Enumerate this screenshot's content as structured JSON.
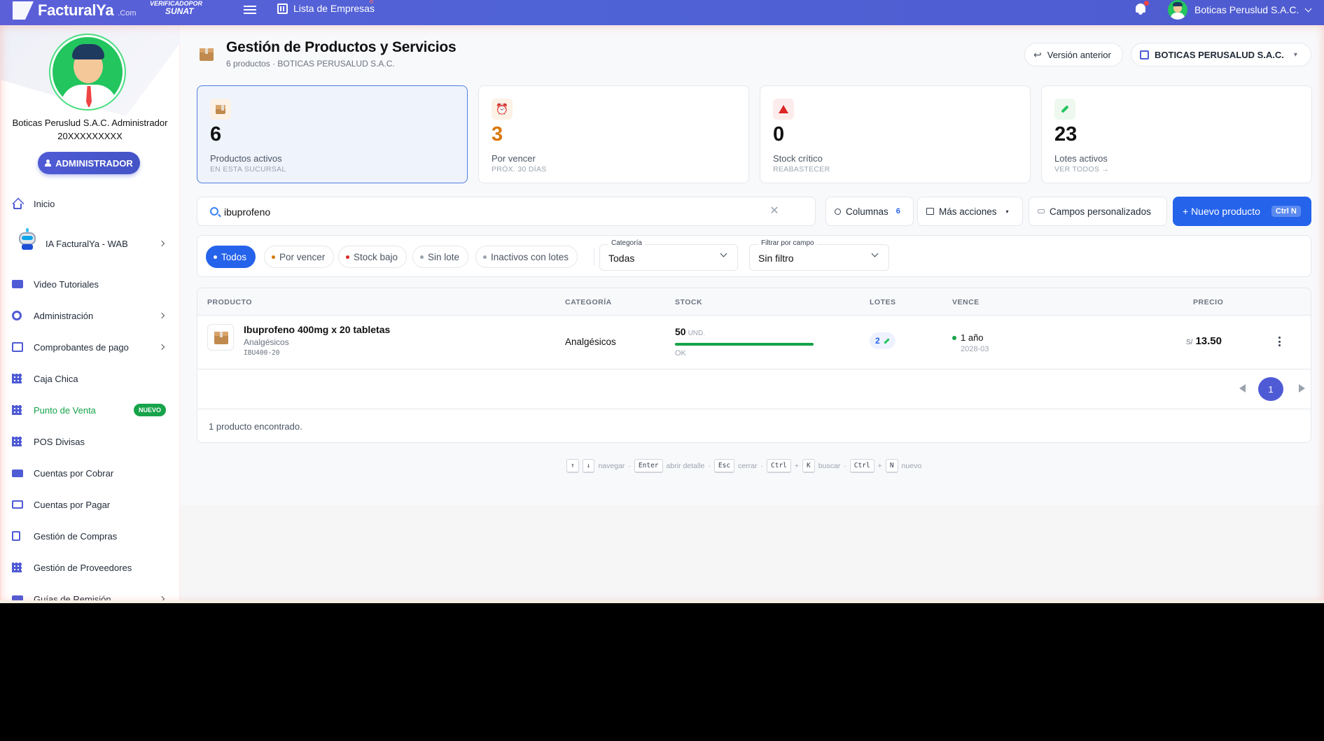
{
  "topbar": {
    "logo_text": "FacturalYa",
    "logo_suffix": ".Com",
    "verify_line1": "VERIFICADOPOR",
    "verify_line2": "SUNAT",
    "company_list_label": "Lista de Empresas",
    "user_name": "Boticas Peruslud S.A.C."
  },
  "sidebar": {
    "user_name": "Boticas Peruslud S.A.C. Administrador",
    "user_ruc": "20XXXXXXXXX",
    "role_label": "ADMINISTRADOR",
    "items": [
      {
        "label": "Inicio",
        "icon": "home-icon"
      },
      {
        "label": "IA FacturalYa - WAB",
        "icon": "robot-icon",
        "has_submenu": true
      },
      {
        "label": "Video Tutoriales",
        "icon": "video-icon"
      },
      {
        "label": "Administración",
        "icon": "gear-icon",
        "has_submenu": true
      },
      {
        "label": "Comprobantes de pago",
        "icon": "receipt-icon",
        "has_submenu": true
      },
      {
        "label": "Caja Chica",
        "icon": "calculator-icon"
      },
      {
        "label": "Punto de Venta",
        "icon": "store-icon",
        "badge": "NUEVO",
        "active": true
      },
      {
        "label": "POS Divisas",
        "icon": "store-icon"
      },
      {
        "label": "Cuentas por Cobrar",
        "icon": "money-icon"
      },
      {
        "label": "Cuentas por Pagar",
        "icon": "card-icon"
      },
      {
        "label": "Gestión de Compras",
        "icon": "bag-icon"
      },
      {
        "label": "Gestión de Proveedores",
        "icon": "store-icon"
      },
      {
        "label": "Guías de Remisión",
        "icon": "truck-icon",
        "has_submenu": true
      }
    ]
  },
  "header": {
    "title": "Gestión de Productos y Servicios",
    "subtitle": "6 productos · BOTICAS PERUSALUD S.A.C.",
    "prev_version_label": "Versión anterior",
    "company_selector": "BOTICAS PERUSALUD S.A.C."
  },
  "stats": [
    {
      "value": "6",
      "label": "Productos activos",
      "sub": "EN ESTA SUCURSAL",
      "icon": "box-icon",
      "value_color": "#111111"
    },
    {
      "value": "3",
      "label": "Por vencer",
      "sub": "PRÓX. 30 DÍAS",
      "icon": "alarm-clock-icon",
      "value_color": "#d97706"
    },
    {
      "value": "0",
      "label": "Stock crítico",
      "sub": "REABASTECER",
      "icon": "warning-icon",
      "value_color": "#111111"
    },
    {
      "value": "23",
      "label": "Lotes activos",
      "sub": "VER TODOS →",
      "icon": "syringe-icon",
      "value_color": "#111111"
    }
  ],
  "search": {
    "value": "ibuprofeno",
    "clear_glyph": "✕"
  },
  "actions": {
    "columns_label": "Columnas",
    "columns_count": "6",
    "more_label": "Más acciones",
    "custom_fields_label": "Campos personalizados",
    "new_product_label": "+ Nuevo producto",
    "new_product_shortcut": "Ctrl N"
  },
  "filters": {
    "chips": [
      {
        "label": "Todos",
        "active": true,
        "dot_color": "#ffffff"
      },
      {
        "label": "Por vencer",
        "dot_color": "#d97706"
      },
      {
        "label": "Stock bajo",
        "dot_color": "#dc2626"
      },
      {
        "label": "Sin lote",
        "dot_color": "#9ca3af"
      },
      {
        "label": "Inactivos con lotes",
        "dot_color": "#9ca3af"
      }
    ],
    "category_caption": "Categoría",
    "category_value": "Todas",
    "field_caption": "Filtrar por campo",
    "field_value": "Sin filtro"
  },
  "table": {
    "headers": [
      "PRODUCTO",
      "CATEGORÍA",
      "STOCK",
      "LOTES",
      "VENCE",
      "PRECIO"
    ],
    "rows": [
      {
        "name": "Ibuprofeno 400mg x 20 tabletas",
        "category_sub": "Analgésicos",
        "code": "IBU400-20",
        "category": "Analgésicos",
        "stock": "50",
        "stock_unit": "UND.",
        "stock_fraction": 1.0,
        "stock_status": "OK",
        "lots": "2",
        "expires": "1 año",
        "expires_date": "2028-03",
        "currency": "S/",
        "price": "13.50"
      }
    ],
    "page": "1",
    "found_text": "1 producto encontrado."
  },
  "shortcuts": [
    {
      "keys": [
        "↑",
        "↓"
      ],
      "desc": "navegar"
    },
    {
      "keys": [
        "Enter"
      ],
      "desc": "abrir detalle"
    },
    {
      "keys": [
        "Esc"
      ],
      "desc": "cerrar"
    },
    {
      "keys": [
        "Ctrl",
        "K"
      ],
      "desc": "buscar"
    },
    {
      "keys": [
        "Ctrl",
        "N"
      ],
      "desc": "nuevo"
    }
  ]
}
